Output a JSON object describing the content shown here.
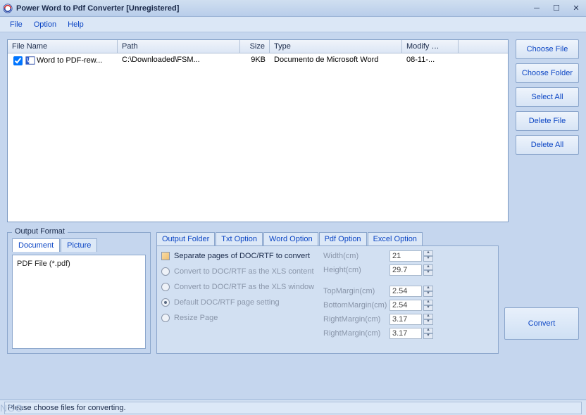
{
  "window": {
    "title": "Power Word to Pdf Converter [Unregistered]"
  },
  "menu": {
    "file": "File",
    "option": "Option",
    "help": "Help"
  },
  "filelist": {
    "headers": {
      "filename": "File Name",
      "path": "Path",
      "size": "Size",
      "type": "Type",
      "modify": "Modify …"
    },
    "rows": [
      {
        "checked": true,
        "filename": "Word to PDF-rew...",
        "path": "C:\\Downloaded\\FSM...",
        "size": "9KB",
        "type": "Documento de Microsoft Word",
        "modify": "08-11-..."
      }
    ]
  },
  "sidebuttons": {
    "choose_file": "Choose File",
    "choose_folder": "Choose Folder",
    "select_all": "Select All",
    "delete_file": "Delete File",
    "delete_all": "Delete All"
  },
  "output_format": {
    "label": "Output Format",
    "tabs": {
      "document": "Document",
      "picture": "Picture"
    },
    "body": "PDF File  (*.pdf)"
  },
  "option_tabs": {
    "output_folder": "Output Folder",
    "txt": "Txt Option",
    "word": "Word Option",
    "pdf": "Pdf Option",
    "excel": "Excel Option"
  },
  "radios": {
    "separate": "Separate pages of DOC/RTF to convert",
    "as_content": "Convert to DOC/RTF as the XLS content",
    "as_window": "Convert to DOC/RTF as the XLS window",
    "default": "Default DOC/RTF page setting",
    "resize": "Resize Page"
  },
  "margins": {
    "width": {
      "label": "Width(cm)",
      "value": "21"
    },
    "height": {
      "label": "Height(cm)",
      "value": "29.7"
    },
    "top": {
      "label": "TopMargin(cm)",
      "value": "2.54"
    },
    "bottom": {
      "label": "BottomMargin(cm)",
      "value": "2.54"
    },
    "right1": {
      "label": "RightMargin(cm)",
      "value": "3.17"
    },
    "right2": {
      "label": "RightMargin(cm)",
      "value": "3.17"
    }
  },
  "convert": "Convert",
  "status": "Please choose files for converting.",
  "watermark": "NSO"
}
